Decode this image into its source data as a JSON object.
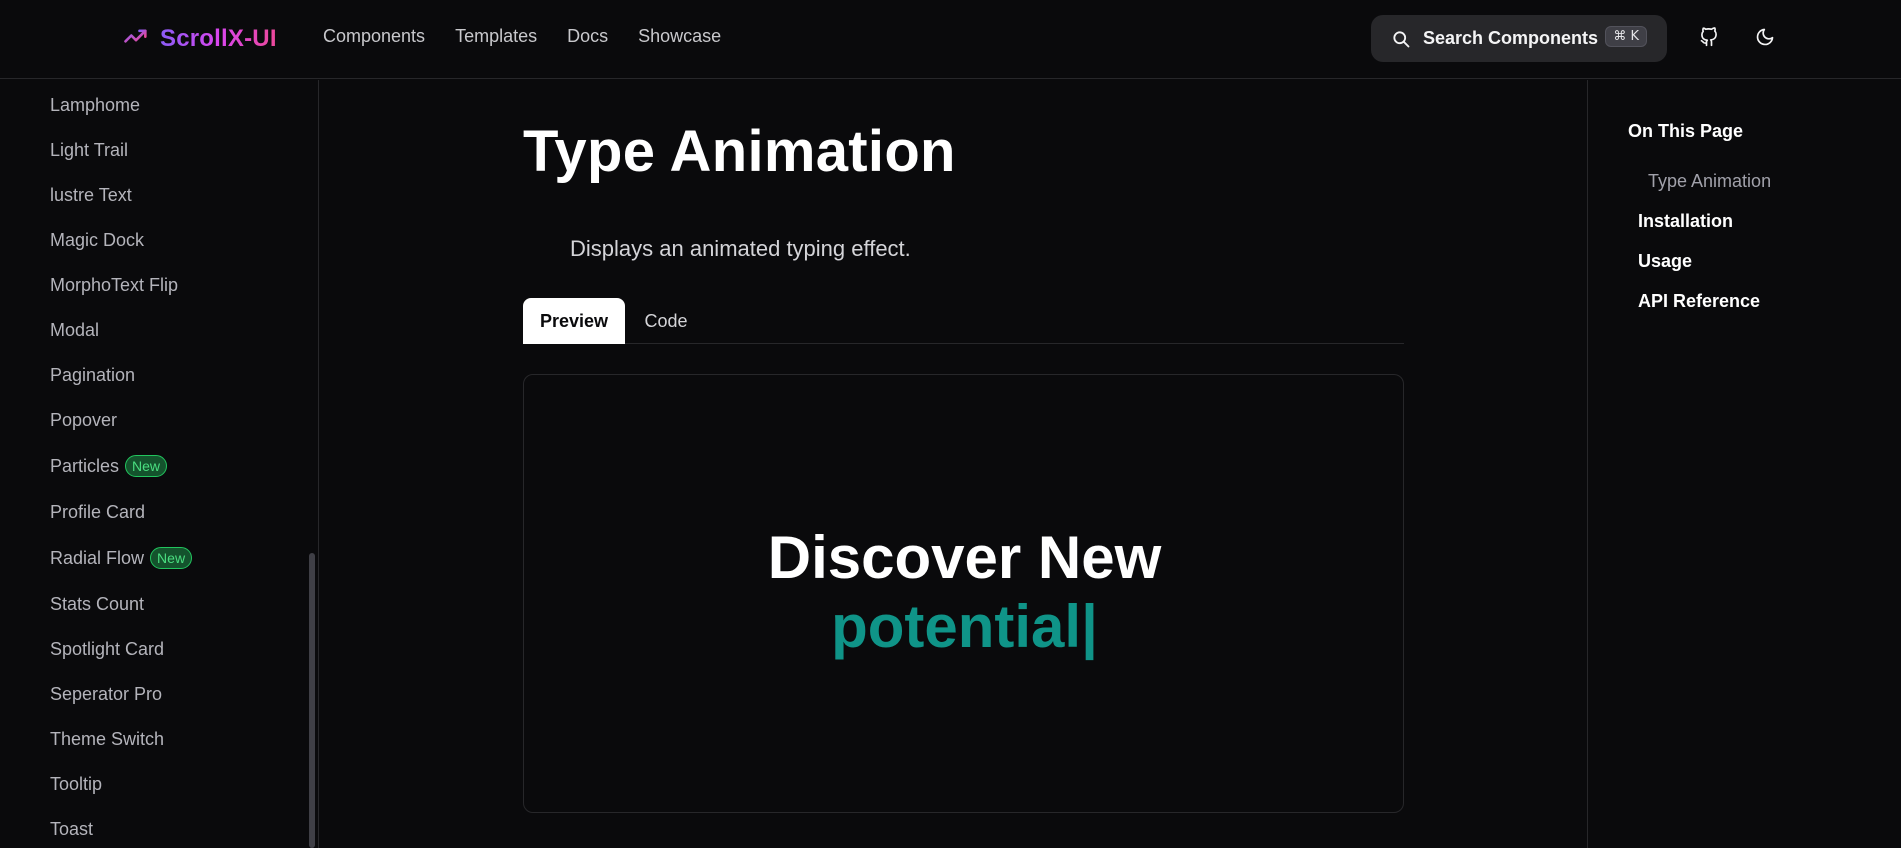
{
  "header": {
    "brand": "ScrollX-UI",
    "nav": [
      "Components",
      "Templates",
      "Docs",
      "Showcase"
    ],
    "search": {
      "label": "Search Components",
      "shortcut": "⌘ K"
    }
  },
  "sidebar": {
    "items": [
      {
        "label": "Lamphome"
      },
      {
        "label": "Light Trail"
      },
      {
        "label": "lustre Text"
      },
      {
        "label": "Magic Dock"
      },
      {
        "label": "MorphoText Flip"
      },
      {
        "label": "Modal"
      },
      {
        "label": "Pagination"
      },
      {
        "label": "Popover"
      },
      {
        "label": "Particles",
        "badge": "New"
      },
      {
        "label": "Profile Card"
      },
      {
        "label": "Radial Flow",
        "badge": "New"
      },
      {
        "label": "Stats Count"
      },
      {
        "label": "Spotlight Card"
      },
      {
        "label": "Seperator Pro"
      },
      {
        "label": "Theme Switch"
      },
      {
        "label": "Tooltip"
      },
      {
        "label": "Toast"
      }
    ]
  },
  "main": {
    "title": "Type Animation",
    "description": "Displays an animated typing effect.",
    "tabs": [
      "Preview",
      "Code"
    ],
    "preview": {
      "line1": "Discover New",
      "line2": "potential|"
    }
  },
  "toc": {
    "title": "On This Page",
    "items": [
      "Type Animation",
      "Installation",
      "Usage",
      "API Reference"
    ]
  },
  "colors": {
    "accent": "#0f9488",
    "badge_green": "#4ade80",
    "background": "#0a0a0c"
  }
}
